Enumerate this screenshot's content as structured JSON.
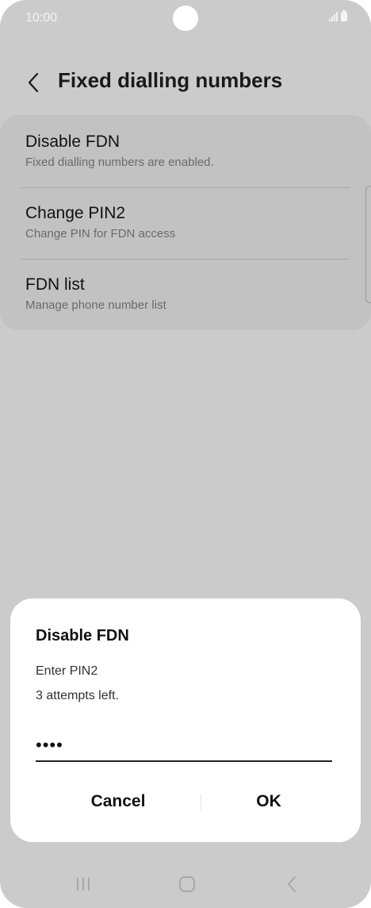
{
  "status_bar": {
    "time": "10:00"
  },
  "header": {
    "title": "Fixed dialling numbers"
  },
  "settings": {
    "items": [
      {
        "title": "Disable FDN",
        "subtitle": "Fixed dialling numbers are enabled."
      },
      {
        "title": "Change PIN2",
        "subtitle": "Change PIN for FDN access"
      },
      {
        "title": "FDN list",
        "subtitle": "Manage phone number list"
      }
    ]
  },
  "dialog": {
    "title": "Disable FDN",
    "message_line1": "Enter PIN2",
    "message_line2": "3 attempts left.",
    "pin_value": "••••",
    "cancel_label": "Cancel",
    "ok_label": "OK"
  },
  "colors": {
    "background_dim": "#cbcbcb",
    "card": "#c2c2c2",
    "dialog": "#ffffff"
  },
  "icons": {
    "back": "chevron-left-icon",
    "recents": "recent-apps-icon",
    "home": "home-icon",
    "nav_back": "back-nav-icon"
  }
}
